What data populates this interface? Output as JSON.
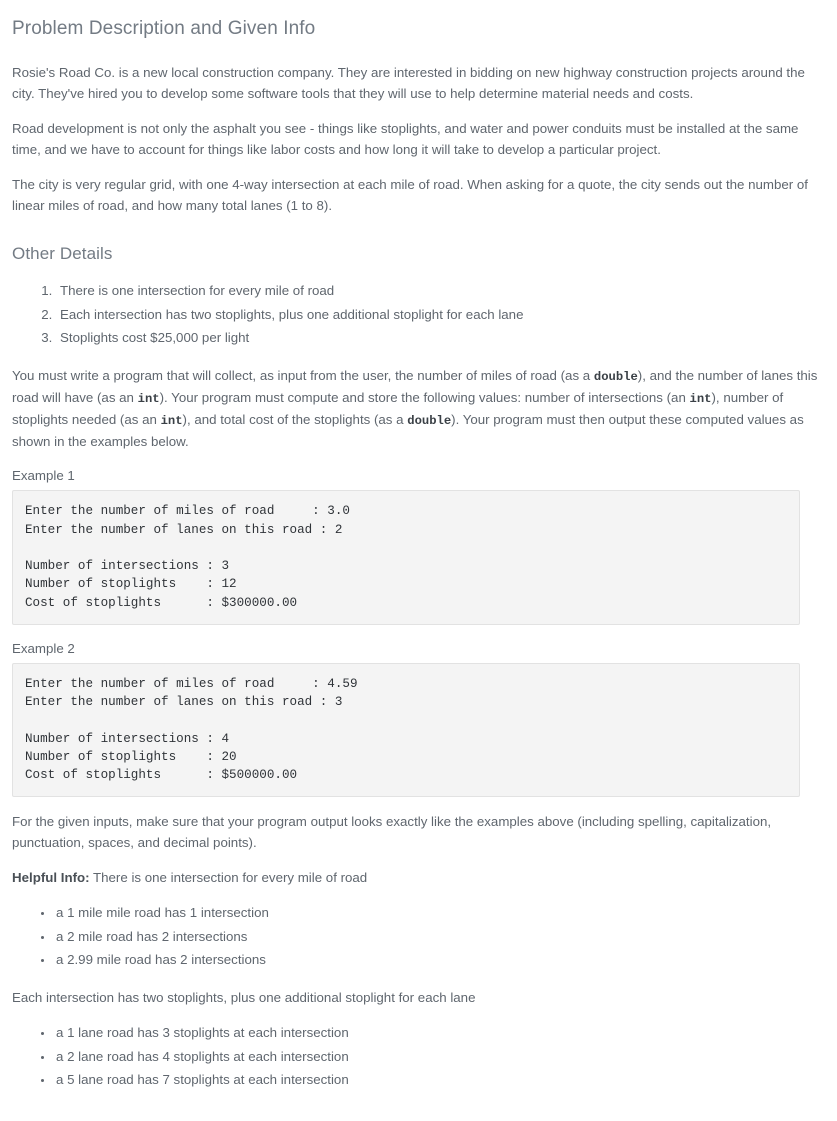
{
  "headings": {
    "main": "Problem Description and Given Info",
    "other_details": "Other Details"
  },
  "intro_paragraphs": [
    "Rosie's Road Co. is a new local construction company. They are interested in bidding on new highway construction projects around the city. They've hired you to develop some software tools that they will use to help determine material needs and costs.",
    "Road development is not only the asphalt you see - things like stoplights, and water and power conduits must be installed at the same time, and we have to account for things like labor costs and how long it will take to develop a particular project.",
    "The city is very regular grid, with one 4-way intersection at each mile of road. When asking for a quote, the city sends out the number of linear miles of road, and how many total lanes (1 to 8)."
  ],
  "other_details_items": [
    "There is one intersection for every mile of road",
    "Each intersection has two stoplights, plus one additional stoplight for each lane",
    "Stoplights cost $25,000 per light"
  ],
  "requirements": {
    "part1": "You must write a program that will collect, as input from the user, the number of miles of road (as a ",
    "code1": "double",
    "part2": "), and the number of lanes this road will have (as an ",
    "code2": "int",
    "part3": "). Your program must compute and store the following values: number of intersections (an ",
    "code3": "int",
    "part4": "), number of stoplights needed (as an ",
    "code4": "int",
    "part5": "), and total cost of the stoplights (as a ",
    "code5": "double",
    "part6": "). Your program must then output these computed values as shown in the examples below."
  },
  "examples": [
    {
      "label": "Example 1",
      "code": "Enter the number of miles of road     : 3.0\nEnter the number of lanes on this road : 2\n\nNumber of intersections : 3\nNumber of stoplights    : 12\nCost of stoplights      : $300000.00"
    },
    {
      "label": "Example 2",
      "code": "Enter the number of miles of road     : 4.59\nEnter the number of lanes on this road : 3\n\nNumber of intersections : 4\nNumber of stoplights    : 20\nCost of stoplights      : $500000.00"
    }
  ],
  "closing": {
    "exactness_note": "For the given inputs, make sure that your program output looks exactly like the examples above (including spelling, capitalization, punctuation, spaces, and decimal points).",
    "helpful_label": "Helpful Info:",
    "helpful_text": " There is one intersection for every mile of road",
    "intersection_examples": [
      "a 1 mile mile road has 1 intersection",
      "a 2 mile road has 2 intersections",
      "a 2.99 mile road has 2 intersections"
    ],
    "stoplight_rule": "Each intersection has two stoplights, plus one additional stoplight for each lane",
    "stoplight_examples": [
      "a 1 lane road has 3 stoplights at each intersection",
      "a 2 lane road has 4 stoplights at each intersection",
      "a 5 lane road has 7 stoplights at each intersection"
    ]
  }
}
